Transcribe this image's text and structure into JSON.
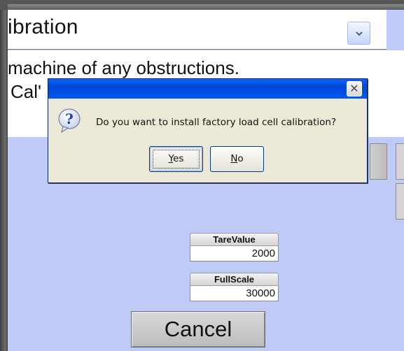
{
  "header": {
    "combo_text": "ibration",
    "combo_arrow_icon": "chevron-down-icon"
  },
  "instructions": {
    "line1": "machine of any obstructions.",
    "line2": "Cal'"
  },
  "fields": {
    "tare_label": "TareValue",
    "tare_value": "2000",
    "fullscale_label": "FullScale",
    "fullscale_value": "30000"
  },
  "cancel_label": "Cancel",
  "dialog": {
    "message": "Do you want to install factory load cell calibration?",
    "yes_accel": "Y",
    "yes_rest": "es",
    "no_accel": "N",
    "no_rest": "o",
    "icon": "question-icon",
    "close_icon": "close-icon"
  },
  "colors": {
    "background": "#bfcaf7",
    "titlebar": "#0058ee",
    "dialog_face": "#ece9d8"
  }
}
